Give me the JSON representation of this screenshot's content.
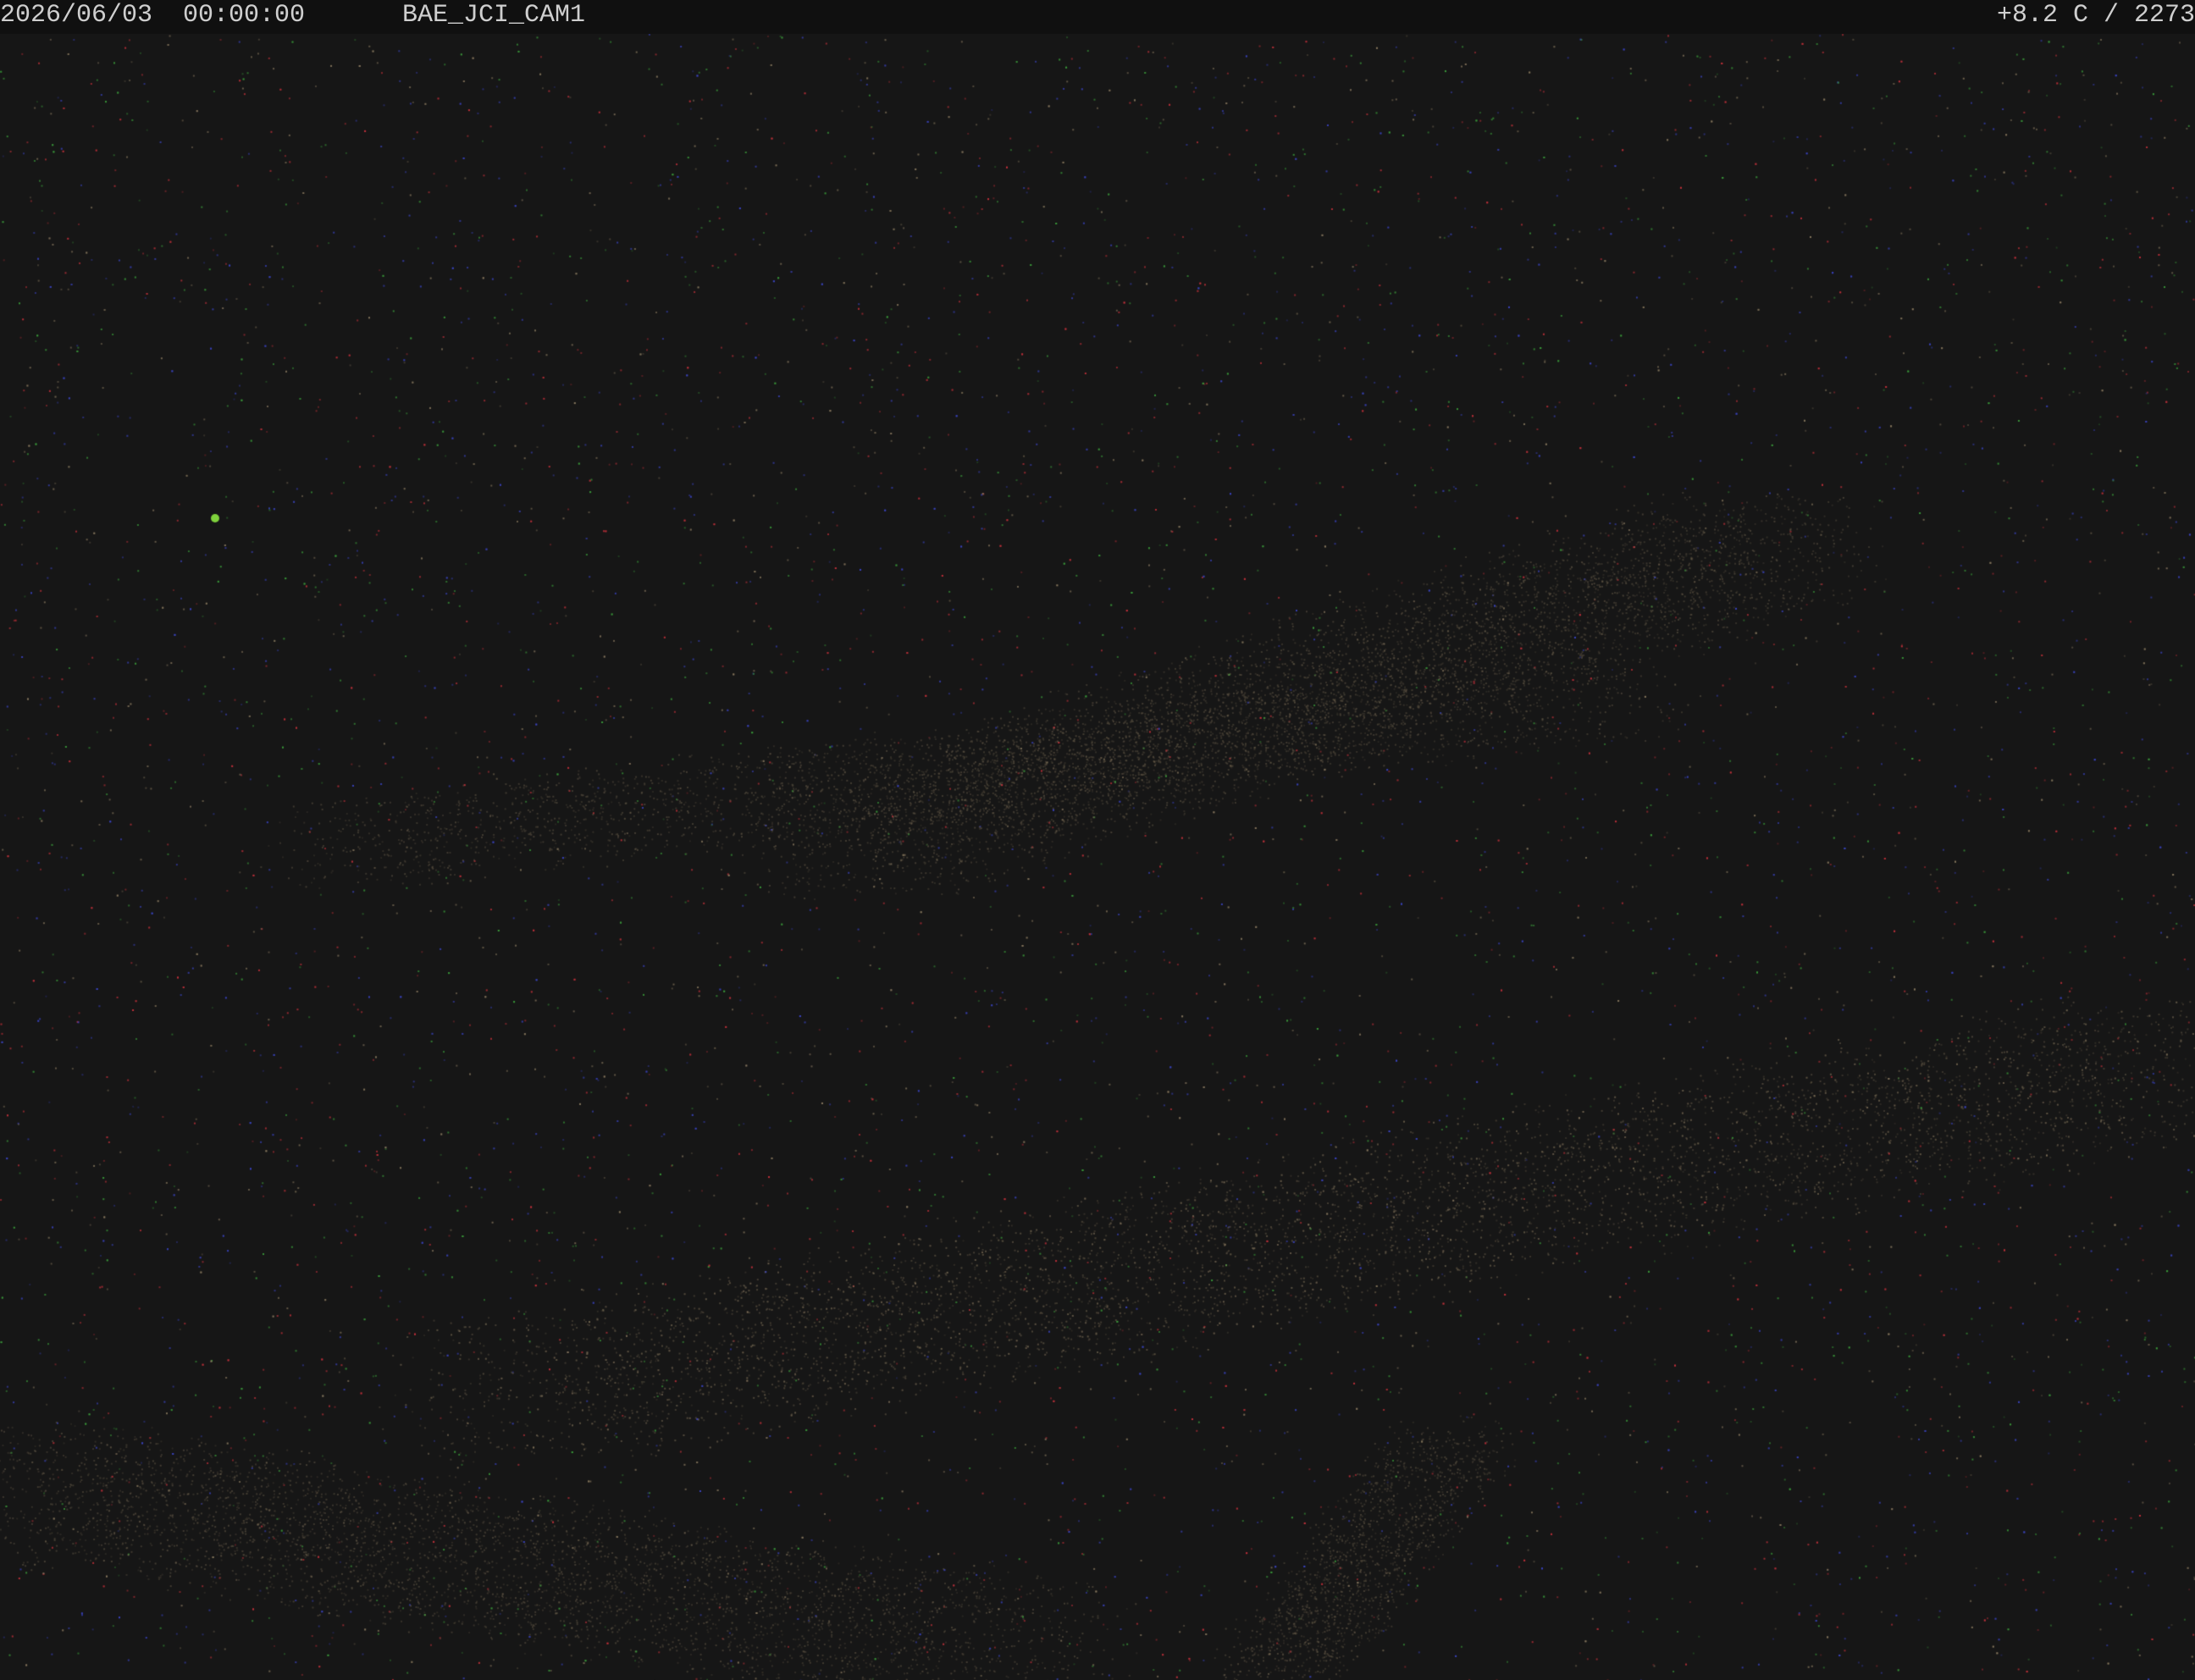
{
  "overlay": {
    "datetime": "2026/06/03  00:00:00",
    "camera_name": "BAE_JCI_CAM1",
    "telemetry": "+8.2 C / 2273"
  },
  "scene": {
    "description_type": "night-sky-noise",
    "background_color": "#161616",
    "bar_color": "#101010",
    "text_color": "#cfcfcf",
    "noise_colors": [
      "#c8323c",
      "#3c46c8",
      "#3ca03c",
      "#8a7a60"
    ],
    "highlight_color": "#7fd23c"
  }
}
